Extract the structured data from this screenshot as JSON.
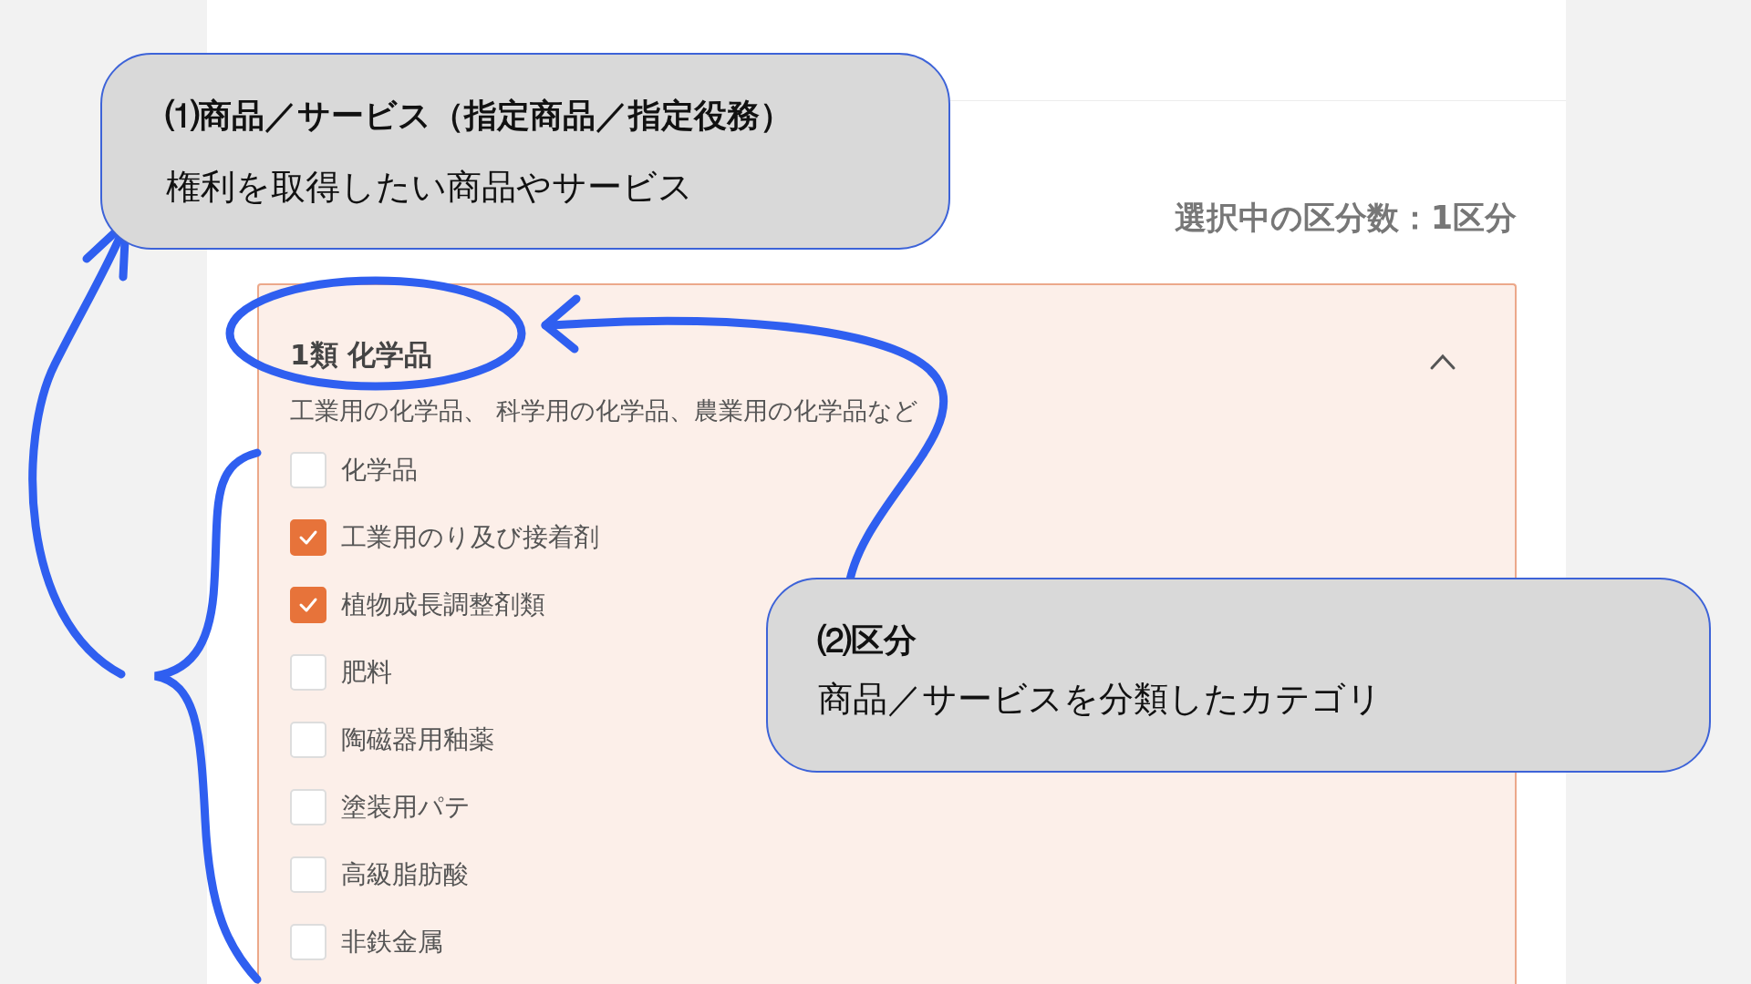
{
  "selection_count": "選択中の区分数：1区分",
  "category": {
    "title": "1類 化学品",
    "description": "工業用の化学品、 科学用の化学品、農業用の化学品など",
    "expanded": true,
    "items": [
      {
        "label": "化学品",
        "checked": false
      },
      {
        "label": "工業用のり及び接着剤",
        "checked": true
      },
      {
        "label": "植物成長調整剤類",
        "checked": true
      },
      {
        "label": "肥料",
        "checked": false
      },
      {
        "label": "陶磁器用釉薬",
        "checked": false
      },
      {
        "label": "塗装用パテ",
        "checked": false
      },
      {
        "label": "高級脂肪酸",
        "checked": false
      },
      {
        "label": "非鉄金属",
        "checked": false
      }
    ]
  },
  "callouts": [
    {
      "title": "⑴商品／サービス（指定商品／指定役務）",
      "text": "権利を取得したい商品やサービス"
    },
    {
      "title": "⑵区分",
      "text": "商品／サービスを分類したカテゴリ"
    }
  ]
}
